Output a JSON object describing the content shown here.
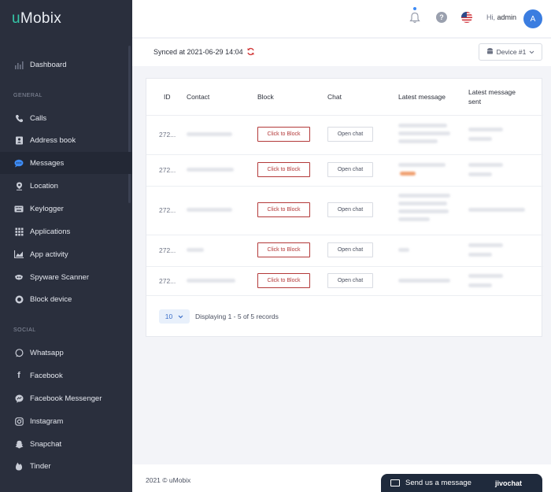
{
  "app": {
    "logo_prefix": "u",
    "logo_rest": "Mobix"
  },
  "sidebar": {
    "dashboard": {
      "label": "Dashboard",
      "icon": "chart-icon"
    },
    "general_title": "GENERAL",
    "general": [
      {
        "label": "Calls",
        "icon": "phone-icon"
      },
      {
        "label": "Address book",
        "icon": "address-book-icon"
      },
      {
        "label": "Messages",
        "icon": "message-icon",
        "active": true
      },
      {
        "label": "Location",
        "icon": "location-pin-icon"
      },
      {
        "label": "Keylogger",
        "icon": "keyboard-icon"
      },
      {
        "label": "Applications",
        "icon": "grid-icon"
      },
      {
        "label": "App activity",
        "icon": "activity-chart-icon"
      },
      {
        "label": "Spyware Scanner",
        "icon": "scanner-icon"
      },
      {
        "label": "Block device",
        "icon": "block-icon"
      }
    ],
    "social_title": "SOCIAL",
    "social": [
      {
        "label": "Whatsapp",
        "icon": "whatsapp-icon"
      },
      {
        "label": "Facebook",
        "icon": "facebook-icon"
      },
      {
        "label": "Facebook Messenger",
        "icon": "messenger-icon"
      },
      {
        "label": "Instagram",
        "icon": "instagram-icon"
      },
      {
        "label": "Snapchat",
        "icon": "snapchat-icon"
      },
      {
        "label": "Tinder",
        "icon": "tinder-icon"
      }
    ]
  },
  "header": {
    "greeting": "Hi,",
    "username": "admin",
    "avatar_letter": "A",
    "help_glyph": "?"
  },
  "sync": {
    "text": "Synced at 2021-06-29 14:04",
    "device_label": "Device #1"
  },
  "table": {
    "headers": {
      "id": "ID",
      "contact": "Contact",
      "block": "Block",
      "chat": "Chat",
      "latest_message": "Latest message",
      "latest_sent_1": "Latest message",
      "latest_sent_2": "sent"
    },
    "rows": [
      {
        "id": "272...",
        "block_label": "Click to Block",
        "chat_label": "Open chat"
      },
      {
        "id": "272...",
        "block_label": "Click to Block",
        "chat_label": "Open chat"
      },
      {
        "id": "272...",
        "block_label": "Click to Block",
        "chat_label": "Open chat"
      },
      {
        "id": "272...",
        "block_label": "Click to Block",
        "chat_label": "Open chat"
      },
      {
        "id": "272...",
        "block_label": "Click to Block",
        "chat_label": "Open chat"
      }
    ]
  },
  "pagination": {
    "per_page": "10",
    "records_text": "Displaying 1 - 5 of 5 records"
  },
  "footer": {
    "copyright": "2021 © uMobix"
  },
  "chat_widget": {
    "label": "Send us a message",
    "brand": "jivochat"
  },
  "colors": {
    "sidebar_bg": "#2a2f3d",
    "accent": "#3d8bf5",
    "block_red": "#b33939",
    "logo_accent": "#35c7a8"
  }
}
